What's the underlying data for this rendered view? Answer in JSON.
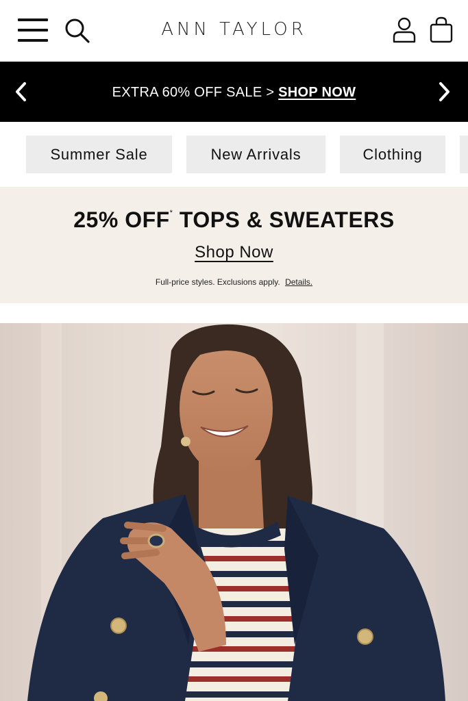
{
  "header": {
    "brand": "ANN TAYLOR",
    "icons": [
      "menu-icon",
      "search-icon",
      "account-icon",
      "shopping-bag-icon"
    ]
  },
  "promo_bar": {
    "text": "EXTRA 60% OFF SALE >",
    "link": "SHOP NOW",
    "prev_icon": "chevron-left-icon",
    "next_icon": "chevron-right-icon"
  },
  "categories": [
    {
      "label": "Summer Sale"
    },
    {
      "label": "New Arrivals"
    },
    {
      "label": "Clothing"
    },
    {
      "label": ""
    }
  ],
  "offer": {
    "headline_pct": "25% OFF",
    "asterisk": "*",
    "headline_rest": "TOPS & SWEATERS",
    "cta": "Shop Now",
    "fine_print": "Full-price styles. Exclusions apply.",
    "details_link": "Details."
  },
  "colors": {
    "promo_bg": "#000000",
    "chip_bg": "#ececec",
    "offer_bg": "#f5efe9",
    "blazer": "#1f2a44",
    "stripe_red": "#9c2f2a"
  }
}
